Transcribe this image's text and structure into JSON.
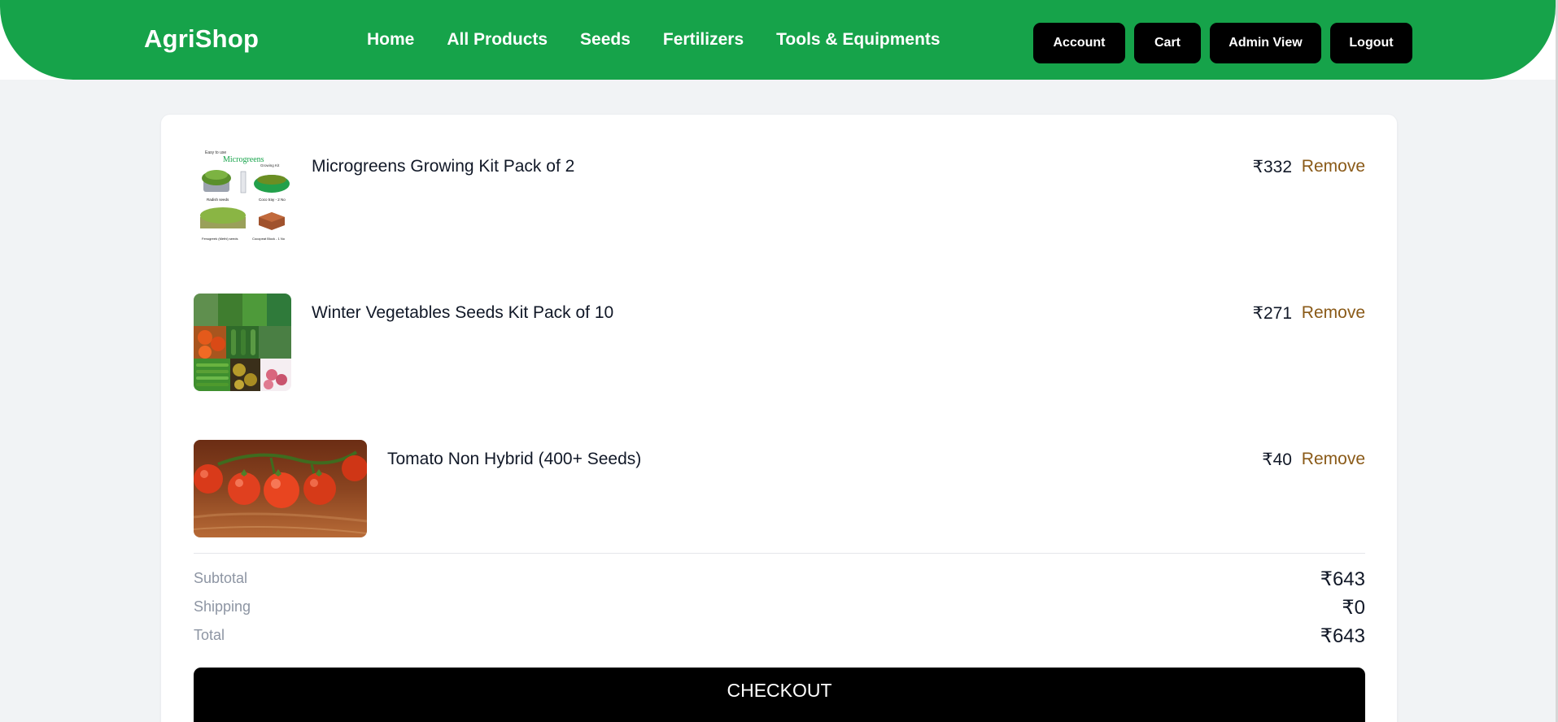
{
  "brand": "AgriShop",
  "nav": {
    "links": [
      "Home",
      "All Products",
      "Seeds",
      "Fertilizers",
      "Tools & Equipments"
    ],
    "buttons": {
      "account": "Account",
      "cart": "Cart",
      "admin": "Admin View",
      "logout": "Logout"
    }
  },
  "cart": {
    "items": [
      {
        "name": "Microgreens Growing Kit Pack of 2",
        "price": "₹332",
        "remove": "Remove"
      },
      {
        "name": "Winter Vegetables Seeds Kit Pack of 10",
        "price": "₹271",
        "remove": "Remove"
      },
      {
        "name": "Tomato Non Hybrid (400+ Seeds)",
        "price": "₹40",
        "remove": "Remove"
      }
    ],
    "microgreens_image_text": {
      "top": "Easy to use",
      "title": "Microgreens",
      "subtitle": "Growing Kit",
      "labels": [
        "Radish seeds",
        "Coco tray - 2 No",
        "Fenugreek (Methi) seeds",
        "Cocopeat Block - 1 No"
      ]
    }
  },
  "summary": {
    "subtotal_label": "Subtotal",
    "subtotal": "₹643",
    "shipping_label": "Shipping",
    "shipping": "₹0",
    "total_label": "Total",
    "total": "₹643"
  },
  "checkout_label": "CHECKOUT",
  "colors": {
    "brand_green": "#16a34a",
    "button_black": "#000000",
    "remove_brown": "#8a5a18",
    "page_bg": "#f1f3f5"
  }
}
